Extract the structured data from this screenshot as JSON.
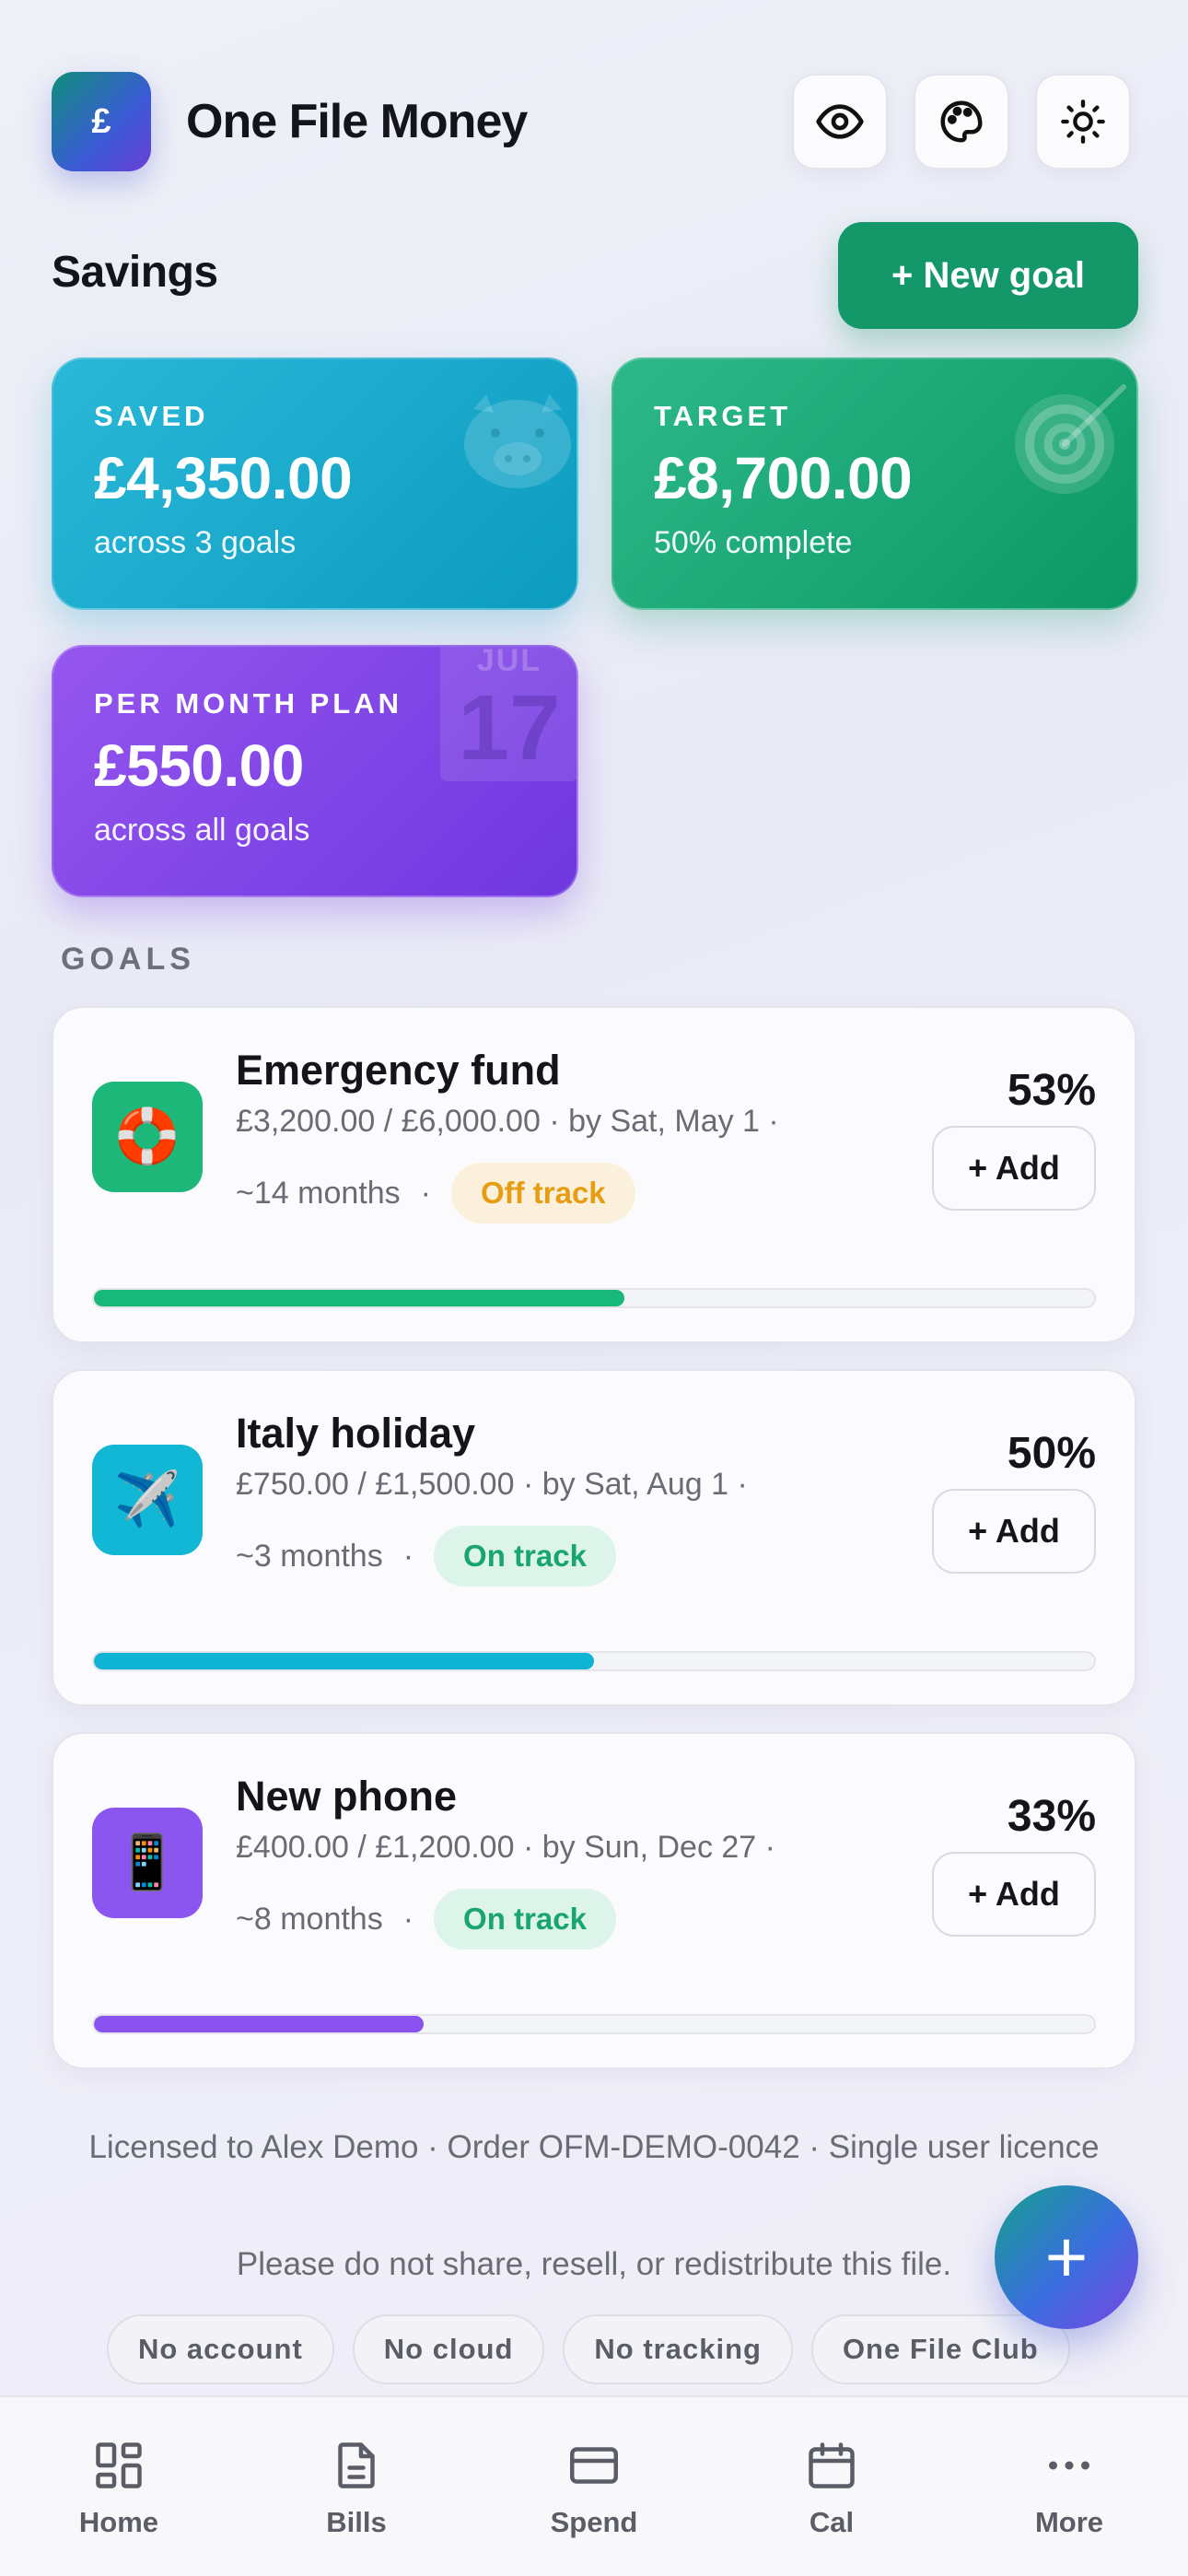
{
  "app": {
    "logo_glyph": "£",
    "title": "One File Money",
    "header_icons": [
      "eye-icon",
      "palette-icon",
      "sun-icon"
    ]
  },
  "savings": {
    "title": "Savings",
    "new_goal_label": "+ New goal",
    "stats": {
      "saved": {
        "label": "SAVED",
        "value": "£4,350.00",
        "sub": "across 3 goals",
        "icon": "piggy-bank-icon"
      },
      "target": {
        "label": "TARGET",
        "value": "£8,700.00",
        "sub": "50% complete",
        "icon": "target-icon"
      },
      "plan": {
        "label": "PER MONTH PLAN",
        "value": "£550.00",
        "sub": "across all goals",
        "icon": "calendar-icon",
        "cal_month": "JUL",
        "cal_day": "17"
      }
    }
  },
  "goals": {
    "label": "GOALS",
    "items": [
      {
        "name": "Emergency fund",
        "icon": "lifebuoy-icon",
        "icon_glyph": "🛟",
        "icon_color": "#1db879",
        "amounts": "£3,200.00 / £6,000.00",
        "due": "by Sat, May 1",
        "duration": "~14 months",
        "status": "Off track",
        "percent_label": "53%",
        "progress": 0.53,
        "bar_color": "#18b87a",
        "add_label": "+ Add"
      },
      {
        "name": "Italy holiday",
        "icon": "airplane-icon",
        "icon_glyph": "✈️",
        "icon_color": "#12b7d6",
        "amounts": "£750.00 / £1,500.00",
        "due": "by Sat, Aug 1",
        "duration": "~3 months",
        "status": "On track",
        "percent_label": "50%",
        "progress": 0.5,
        "bar_color": "#0fb4d4",
        "add_label": "+ Add"
      },
      {
        "name": "New phone",
        "icon": "phone-icon",
        "icon_glyph": "📱",
        "icon_color": "#8b56f0",
        "amounts": "£400.00 / £1,200.00",
        "due": "by Sun, Dec 27",
        "duration": "~8 months",
        "status": "On track",
        "percent_label": "33%",
        "progress": 0.33,
        "bar_color": "#8a52ef",
        "add_label": "+ Add"
      }
    ]
  },
  "footer": {
    "license": "Licensed to Alex Demo · Order OFM-DEMO-0042 · Single user licence",
    "warning": "Please do not share, resell, or redistribute this file.",
    "chips": [
      "No account",
      "No cloud",
      "No tracking",
      "One File Club"
    ]
  },
  "fab_label": "+",
  "nav": [
    {
      "label": "Home",
      "icon": "grid-icon"
    },
    {
      "label": "Bills",
      "icon": "document-icon"
    },
    {
      "label": "Spend",
      "icon": "card-icon"
    },
    {
      "label": "Cal",
      "icon": "calendar-icon"
    },
    {
      "label": "More",
      "icon": "more-icon"
    }
  ]
}
